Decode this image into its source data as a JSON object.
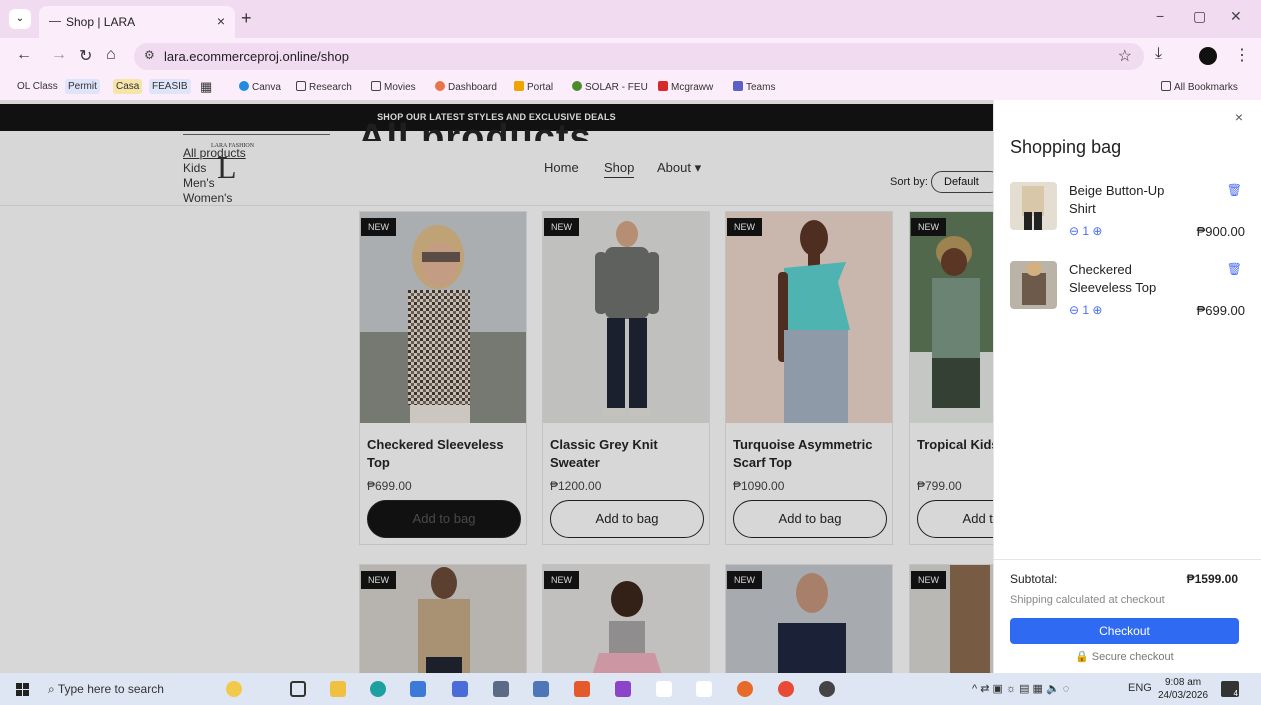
{
  "browser": {
    "tab_title": "Shop | LARA",
    "tab_close": "×",
    "new_tab": "+",
    "url": "lara.ecommerceproj.online/shop",
    "window_minimize": "−",
    "window_maximize": "▢",
    "window_close": "✕",
    "bookmarks": [
      "OL Class",
      "Permit",
      "Casa",
      "FEASIB",
      "Canva",
      "Research",
      "Movies",
      "Dashboard",
      "Portal",
      "SOLAR - FEU",
      "Mcgraww",
      "Teams"
    ],
    "all_bookmarks": "All Bookmarks"
  },
  "site": {
    "promo": "SHOP OUR LATEST STYLES AND EXCLUSIVE DEALS",
    "page_title": "All products",
    "logo_arc": "LARA FASHION",
    "logo_letter": "L",
    "categories": [
      "All products",
      "Kids",
      "Men's",
      "Women's"
    ],
    "nav": {
      "home": "Home",
      "shop": "Shop",
      "about": "About ▾"
    },
    "sort_label": "Sort by:",
    "sort_value": "Default"
  },
  "products": [
    {
      "badge": "NEW",
      "name": "Checkered Sleeveless Top",
      "price": "₱699.00",
      "button": "Add to bag"
    },
    {
      "badge": "NEW",
      "name": "Classic Grey Knit Sweater",
      "price": "₱1200.00",
      "button": "Add to bag"
    },
    {
      "badge": "NEW",
      "name": "Turquoise Asymmetric Scarf Top",
      "price": "₱1090.00",
      "button": "Add to bag"
    },
    {
      "badge": "NEW",
      "name": "Tropical Kids Set",
      "price": "₱799.00",
      "button": "Add to bag"
    }
  ],
  "products_row2": [
    {
      "badge": "NEW"
    },
    {
      "badge": "NEW"
    },
    {
      "badge": "NEW"
    },
    {
      "badge": "NEW"
    }
  ],
  "cart": {
    "title": "Shopping bag",
    "close": "×",
    "items": [
      {
        "name": "Beige Button-Up Shirt",
        "qty": "⊖ 1 ⊕",
        "price": "₱900.00"
      },
      {
        "name": "Checkered Sleeveless Top",
        "qty": "⊖ 1 ⊕",
        "price": "₱699.00"
      }
    ],
    "subtotal_label": "Subtotal:",
    "subtotal_value": "₱1599.00",
    "shipping_note": "Shipping calculated at checkout",
    "checkout": "Checkout",
    "secure": "Secure checkout"
  },
  "taskbar": {
    "search_placeholder": "Type here to search",
    "tray_lang": "ENG",
    "time": "9:08 am",
    "date": "24/03/2026",
    "notifications": "4"
  }
}
